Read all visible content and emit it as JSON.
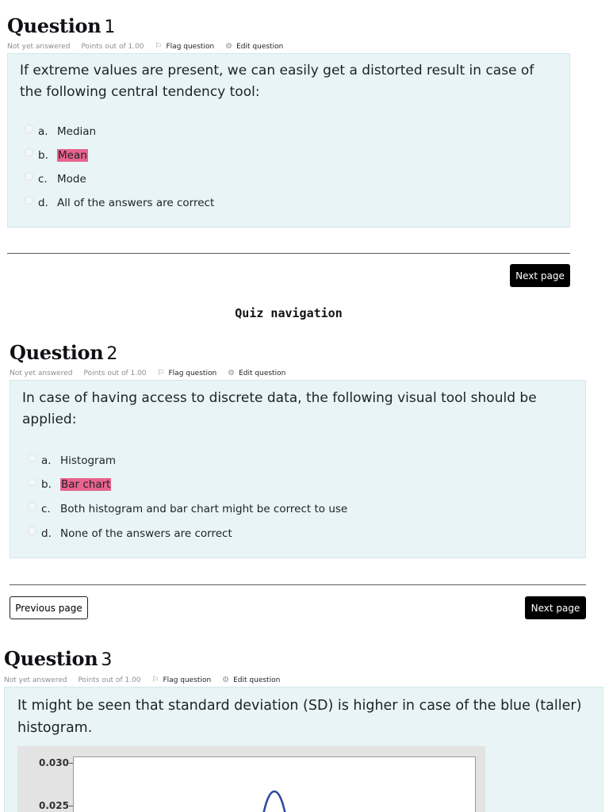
{
  "questions": [
    {
      "word": "Question",
      "number": "1",
      "status": "Not yet answered",
      "points": "Points out of 1.00",
      "flag": "Flag question",
      "edit": "Edit question",
      "text": "If extreme values are present, we can easily get a distorted result in case of the following central tendency tool:",
      "answers": [
        {
          "letter": "a.",
          "text": "Median",
          "highlighted": false
        },
        {
          "letter": "b.",
          "text": "Mean",
          "highlighted": true
        },
        {
          "letter": "c.",
          "text": "Mode",
          "highlighted": false
        },
        {
          "letter": "d.",
          "text": "All of the answers are correct",
          "highlighted": false
        }
      ]
    },
    {
      "word": "Question",
      "number": "2",
      "status": "Not yet answered",
      "points": "Points out of 1.00",
      "flag": "Flag question",
      "edit": "Edit question",
      "text": "In case of having access to discrete data, the following visual tool should be applied:",
      "answers": [
        {
          "letter": "a.",
          "text": "Histogram",
          "highlighted": false
        },
        {
          "letter": "b.",
          "text": "Bar chart",
          "highlighted": true
        },
        {
          "letter": "c.",
          "text": "Both histogram and bar chart might be correct to use",
          "highlighted": false
        },
        {
          "letter": "d.",
          "text": "None of the answers are correct",
          "highlighted": false
        }
      ]
    },
    {
      "word": "Question",
      "number": "3",
      "status": "Not yet answered",
      "points": "Points out of 1.00",
      "flag": "Flag question",
      "edit": "Edit question",
      "text": "It might be seen that standard deviation (SD) is higher in case of the blue (taller) histogram."
    }
  ],
  "nav": {
    "next_page": "Next page",
    "previous_page": "Previous page",
    "quiz_navigation": "Quiz navigation"
  },
  "figure": {
    "y_tick_labels": [
      "0.030",
      "0.025"
    ],
    "curve_color": "#2b4aa0"
  },
  "colors": {
    "question_bg": "#e8f4f6",
    "highlight": "#e8638e",
    "button_dark": "#000000"
  },
  "icons": {
    "flag": "flag-icon",
    "edit": "gear-icon"
  }
}
